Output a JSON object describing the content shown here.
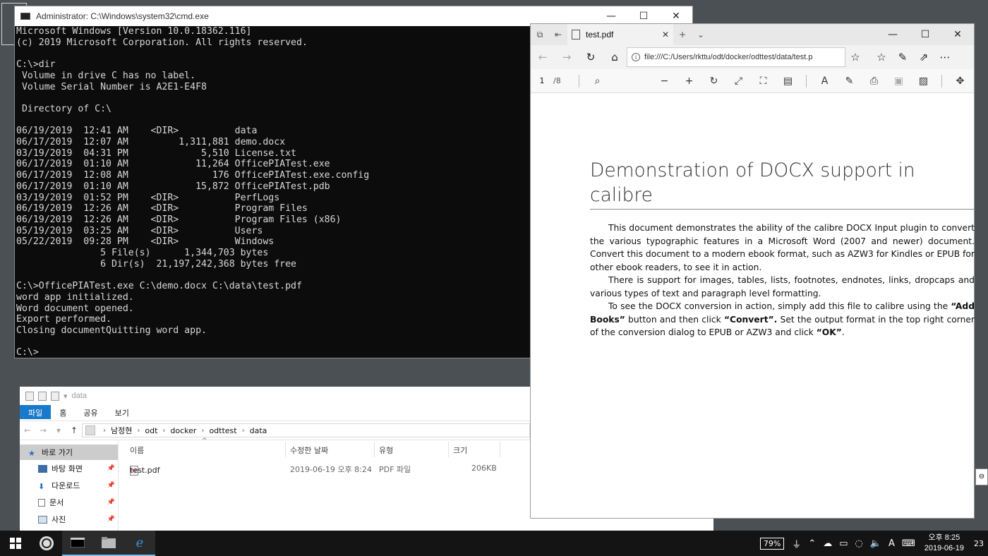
{
  "cmd": {
    "title": "Administrator: C:\\Windows\\system32\\cmd.exe",
    "minimize": "—",
    "maximize": "☐",
    "close": "✕",
    "lines": [
      "Microsoft Windows [Version 10.0.18362.116]",
      "(c) 2019 Microsoft Corporation. All rights reserved.",
      "",
      "C:\\>dir",
      " Volume in drive C has no label.",
      " Volume Serial Number is A2E1-E4F8",
      "",
      " Directory of C:\\",
      "",
      "06/19/2019  12:41 AM    <DIR>          data",
      "06/17/2019  12:07 AM         1,311,881 demo.docx",
      "03/19/2019  04:31 PM             5,510 License.txt",
      "06/17/2019  01:10 AM            11,264 OfficePIATest.exe",
      "06/17/2019  12:08 AM               176 OfficePIATest.exe.config",
      "06/17/2019  01:10 AM            15,872 OfficePIATest.pdb",
      "03/19/2019  01:52 PM    <DIR>          PerfLogs",
      "06/19/2019  12:26 AM    <DIR>          Program Files",
      "06/19/2019  12:26 AM    <DIR>          Program Files (x86)",
      "05/19/2019  03:25 AM    <DIR>          Users",
      "05/22/2019  09:28 PM    <DIR>          Windows",
      "               5 File(s)      1,344,703 bytes",
      "               6 Dir(s)  21,197,242,368 bytes free",
      "",
      "C:\\>OfficePIATest.exe C:\\demo.docx C:\\data\\test.pdf",
      "word app initialized.",
      "Word document opened.",
      "Export performed.",
      "Closing documentQuitting word app.",
      "",
      "C:\\>"
    ]
  },
  "explorer": {
    "qat_label": "data",
    "tabs": [
      "파일",
      "홈",
      "공유",
      "보기"
    ],
    "breadcrumb": [
      "남정현",
      "odt",
      "docker",
      "odttest",
      "data"
    ],
    "nav": {
      "quick_access": "바로 가기",
      "items": [
        "바탕 화면",
        "다운로드",
        "문서",
        "사진"
      ]
    },
    "columns": {
      "name": "이름",
      "modified": "수정한 날짜",
      "type": "유형",
      "size": "크기"
    },
    "files": [
      {
        "name": "test.pdf",
        "modified": "2019-06-19 오후 8:24",
        "type": "PDF 파일",
        "size": "206KB"
      }
    ]
  },
  "edge": {
    "tab_title": "test.pdf",
    "new_tab": "+",
    "url": "file:///C:/Users/rkttu/odt/docker/odttest/data/test.p",
    "page_current": "1",
    "page_total": "/8",
    "document": {
      "title": "Demonstration of DOCX support in calibre",
      "p1": "This document demonstrates the ability of the calibre DOCX Input plugin to convert the various typographic features in a Microsoft Word (2007 and newer) document. Convert this document to a modern ebook format, such as AZW3 for Kindles or EPUB for other ebook readers, to see it in action.",
      "p2": "There is support for images, tables, lists, footnotes, endnotes, links, dropcaps and various types of text and paragraph level formatting.",
      "p3_a": "To see the DOCX conversion in action, simply add this file to calibre using the ",
      "p3_b": "“Add Books”",
      "p3_c": " button and then click ",
      "p3_d": "“Convert”.",
      "p3_e": "  Set the output format in the top right corner of the conversion dialog to EPUB or AZW3 and click ",
      "p3_f": "“OK”",
      "p3_g": "."
    }
  },
  "taskbar": {
    "battery": "79%",
    "ime": "A",
    "time": "오후 8:25",
    "date": "2019-06-19",
    "notifications": "23"
  }
}
